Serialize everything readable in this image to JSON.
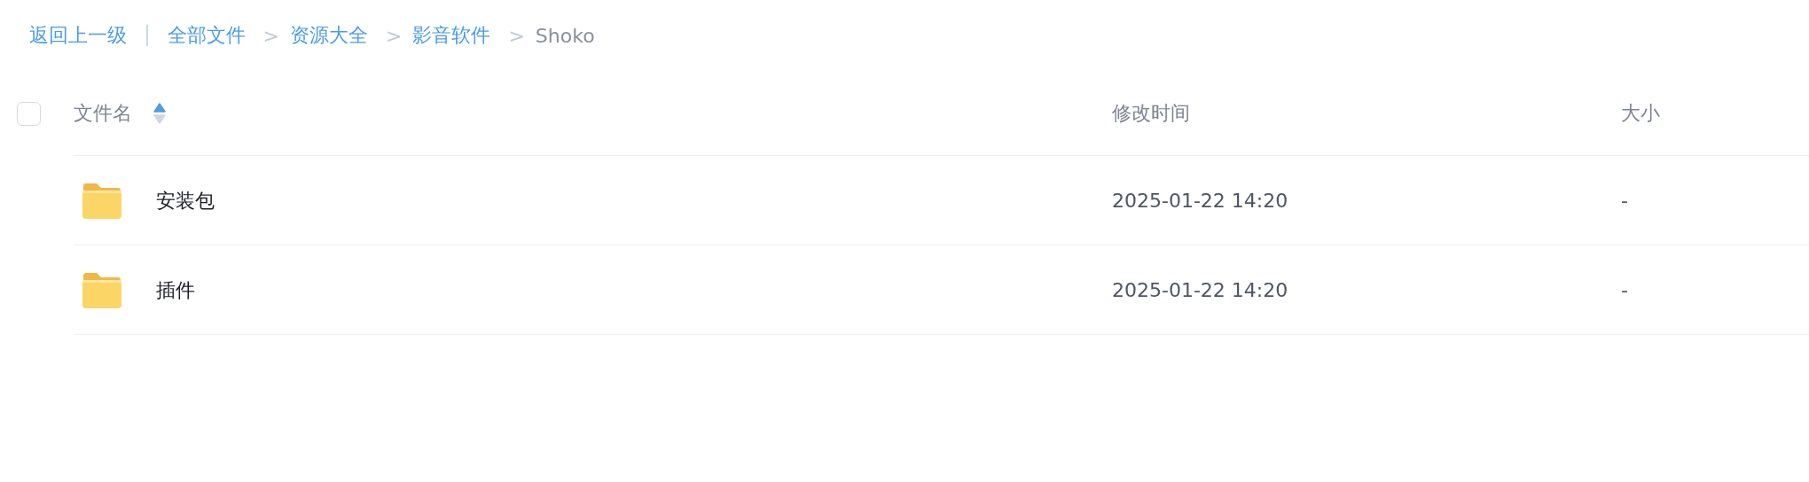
{
  "breadcrumb": {
    "back": "返回上一级",
    "path": [
      {
        "label": "全部文件",
        "current": false
      },
      {
        "separator": ">",
        "label": "资源大全",
        "current": false
      },
      {
        "separator": ">",
        "label": "影音软件",
        "current": false
      },
      {
        "separator": ">",
        "label": "Shoko",
        "current": true
      }
    ]
  },
  "table": {
    "select_all": {
      "checked": false
    },
    "columns": [
      {
        "label": "文件名",
        "sorted_ascending": true
      },
      {
        "label": "修改时间"
      },
      {
        "label": "大小"
      }
    ],
    "rows": [
      {
        "kind": "folder",
        "name": "安装包",
        "modified": "2025-01-22 14:20",
        "size": "-"
      },
      {
        "kind": "folder",
        "name": "插件",
        "modified": "2025-01-22 14:20",
        "size": "-"
      }
    ]
  }
}
